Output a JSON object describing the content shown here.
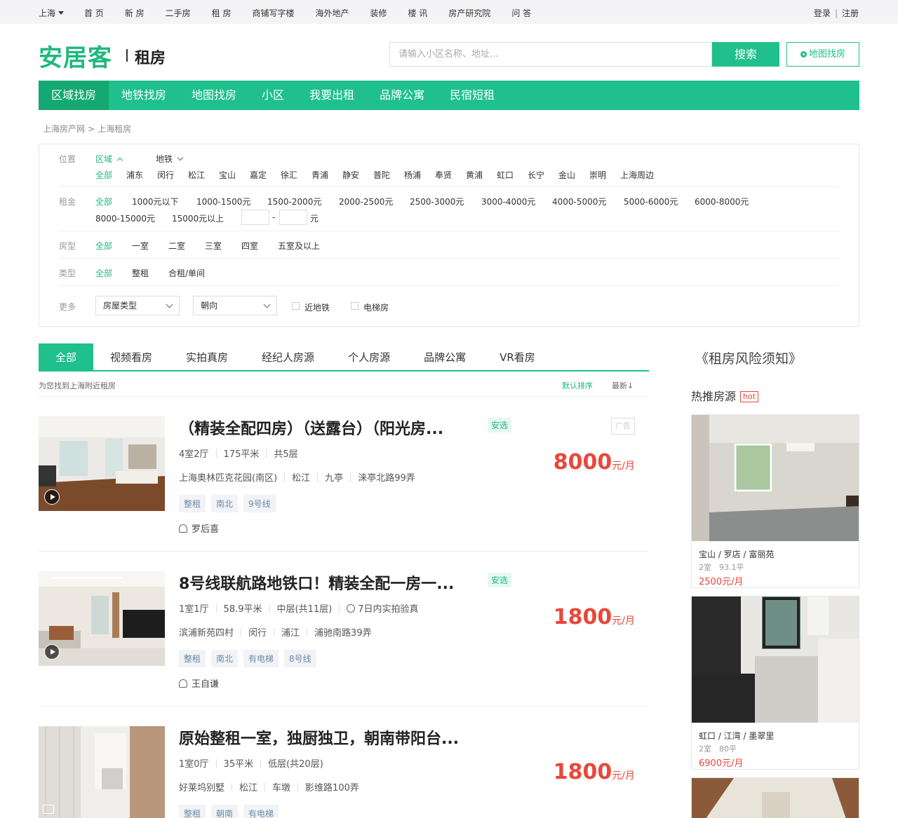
{
  "topbar": {
    "city": "上海",
    "nav": [
      "首 页",
      "新 房",
      "二手房",
      "租 房",
      "商铺写字楼",
      "海外地产",
      "装修",
      "楼 讯",
      "房产研究院",
      "问 答"
    ],
    "login": "登录",
    "register": "注册"
  },
  "header": {
    "logo": "安居客",
    "section": "租房",
    "search_placeholder": "请输入小区名称、地址...",
    "search_button": "搜索",
    "map_button": "地图找房"
  },
  "mainnav": [
    "区域找房",
    "地铁找房",
    "地图找房",
    "小区",
    "我要出租",
    "品牌公寓",
    "民宿短租"
  ],
  "breadcrumb": [
    "上海房产网",
    "上海租房"
  ],
  "filters": {
    "location": {
      "label": "位置",
      "mode_area": "区域",
      "mode_subway": "地铁",
      "options": [
        "全部",
        "浦东",
        "闵行",
        "松江",
        "宝山",
        "嘉定",
        "徐汇",
        "青浦",
        "静安",
        "普陀",
        "杨浦",
        "奉贤",
        "黄浦",
        "虹口",
        "长宁",
        "金山",
        "崇明",
        "上海周边"
      ]
    },
    "rent": {
      "label": "租金",
      "options": [
        "全部",
        "1000元以下",
        "1000-1500元",
        "1500-2000元",
        "2000-2500元",
        "2500-3000元",
        "3000-4000元",
        "4000-5000元",
        "5000-6000元",
        "6000-8000元",
        "8000-15000元",
        "15000元以上"
      ],
      "dash": "-",
      "unit": "元"
    },
    "rooms": {
      "label": "房型",
      "options": [
        "全部",
        "一室",
        "二室",
        "三室",
        "四室",
        "五室及以上"
      ]
    },
    "type": {
      "label": "类型",
      "options": [
        "全部",
        "整租",
        "合租/单间"
      ]
    },
    "more": {
      "label": "更多",
      "select1": "房屋类型",
      "select2": "朝向",
      "check1": "近地铁",
      "check2": "电梯房"
    }
  },
  "tabs": [
    "全部",
    "视频看房",
    "实拍真房",
    "经纪人房源",
    "个人房源",
    "品牌公寓",
    "VR看房"
  ],
  "result_info": "为您找到上海附近租房",
  "sort": {
    "default": "默认排序",
    "newest": "最新↓"
  },
  "listings": [
    {
      "title": "（精装全配四房）（送露台）（阳光房...",
      "badge": "安选",
      "ad": "广告",
      "attrs": [
        "4室2厅",
        "175平米",
        "共5层"
      ],
      "addr": [
        "上海奥林匹克花园(南区)",
        "松江",
        "九亭",
        "涞亭北路99弄"
      ],
      "tags": [
        "整租",
        "南北",
        "9号线"
      ],
      "agent": "罗后喜",
      "price": "8000",
      "unit": "元/月"
    },
    {
      "title": "8号线联航路地铁口！精装全配一房一...",
      "badge": "安选",
      "attrs": [
        "1室1厅",
        "58.9平米",
        "中层(共11层)",
        "7日内实拍验真"
      ],
      "addr": [
        "滨浦新苑四村",
        "闵行",
        "浦江",
        "浦驰南路39弄"
      ],
      "tags": [
        "整租",
        "南北",
        "有电梯",
        "8号线"
      ],
      "agent": "王自谦",
      "price": "1800",
      "unit": "元/月"
    },
    {
      "title": "原始整租一室，独厨独卫，朝南带阳台...",
      "attrs": [
        "1室0厅",
        "35平米",
        "低层(共20层)"
      ],
      "addr": [
        "好莱坞别墅",
        "松江",
        "车墩",
        "影维路100弄"
      ],
      "tags": [
        "整租",
        "朝南",
        "有电梯"
      ],
      "price": "1800",
      "unit": "元/月"
    }
  ],
  "sidebar": {
    "risk": "《租房风险须知》",
    "hot_title": "热推房源",
    "hot_badge": "hot",
    "cards": [
      {
        "loc": "宝山 / 罗店 / 富丽苑",
        "meta": "2室　93.1平",
        "price": "2500元/月"
      },
      {
        "loc": "虹口 / 江湾 / 墨翠里",
        "meta": "2室　80平",
        "price": "6900元/月"
      }
    ]
  },
  "colors": {
    "brand": "#1fc08b",
    "price": "#e8473a"
  }
}
